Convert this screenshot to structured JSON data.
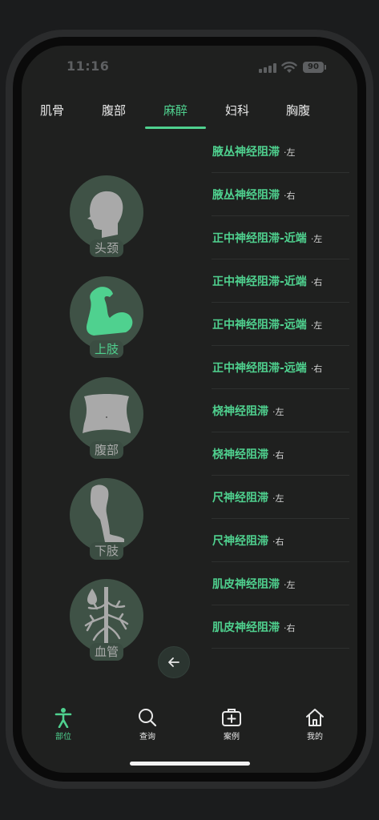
{
  "status": {
    "time": "11:16",
    "battery": "90"
  },
  "tabs": [
    {
      "label": "肌骨",
      "active": false
    },
    {
      "label": "腹部",
      "active": false
    },
    {
      "label": "麻醉",
      "active": true
    },
    {
      "label": "妇科",
      "active": false
    },
    {
      "label": "胸腹",
      "active": false
    }
  ],
  "regions": [
    {
      "label": "头颈",
      "icon": "head-icon",
      "active": false
    },
    {
      "label": "上肢",
      "icon": "arm-icon",
      "active": true
    },
    {
      "label": "腹部",
      "icon": "torso-icon",
      "active": false
    },
    {
      "label": "下肢",
      "icon": "leg-icon",
      "active": false
    },
    {
      "label": "血管",
      "icon": "vessel-icon",
      "active": false
    }
  ],
  "procedures": [
    {
      "name": "腋丛神经阻滞",
      "side": "·左"
    },
    {
      "name": "腋丛神经阻滞",
      "side": "·右"
    },
    {
      "name": "正中神经阻滞-近端",
      "side": "·左"
    },
    {
      "name": "正中神经阻滞-近端",
      "side": "·右"
    },
    {
      "name": "正中神经阻滞-远端",
      "side": "·左"
    },
    {
      "name": "正中神经阻滞-远端",
      "side": "·右"
    },
    {
      "name": "桡神经阻滞",
      "side": "·左"
    },
    {
      "name": "桡神经阻滞",
      "side": "·右"
    },
    {
      "name": "尺神经阻滞",
      "side": "·左"
    },
    {
      "name": "尺神经阻滞",
      "side": "·右"
    },
    {
      "name": "肌皮神经阻滞",
      "side": "·左"
    },
    {
      "name": "肌皮神经阻滞",
      "side": "·右"
    }
  ],
  "bottom_nav": [
    {
      "label": "部位",
      "icon": "person-icon",
      "active": true
    },
    {
      "label": "查询",
      "icon": "search-icon",
      "active": false
    },
    {
      "label": "案例",
      "icon": "case-icon",
      "active": false
    },
    {
      "label": "我的",
      "icon": "home-icon",
      "active": false
    }
  ],
  "colors": {
    "accent": "#4fd18f",
    "background": "#1f201f",
    "circle": "#3f5246"
  }
}
